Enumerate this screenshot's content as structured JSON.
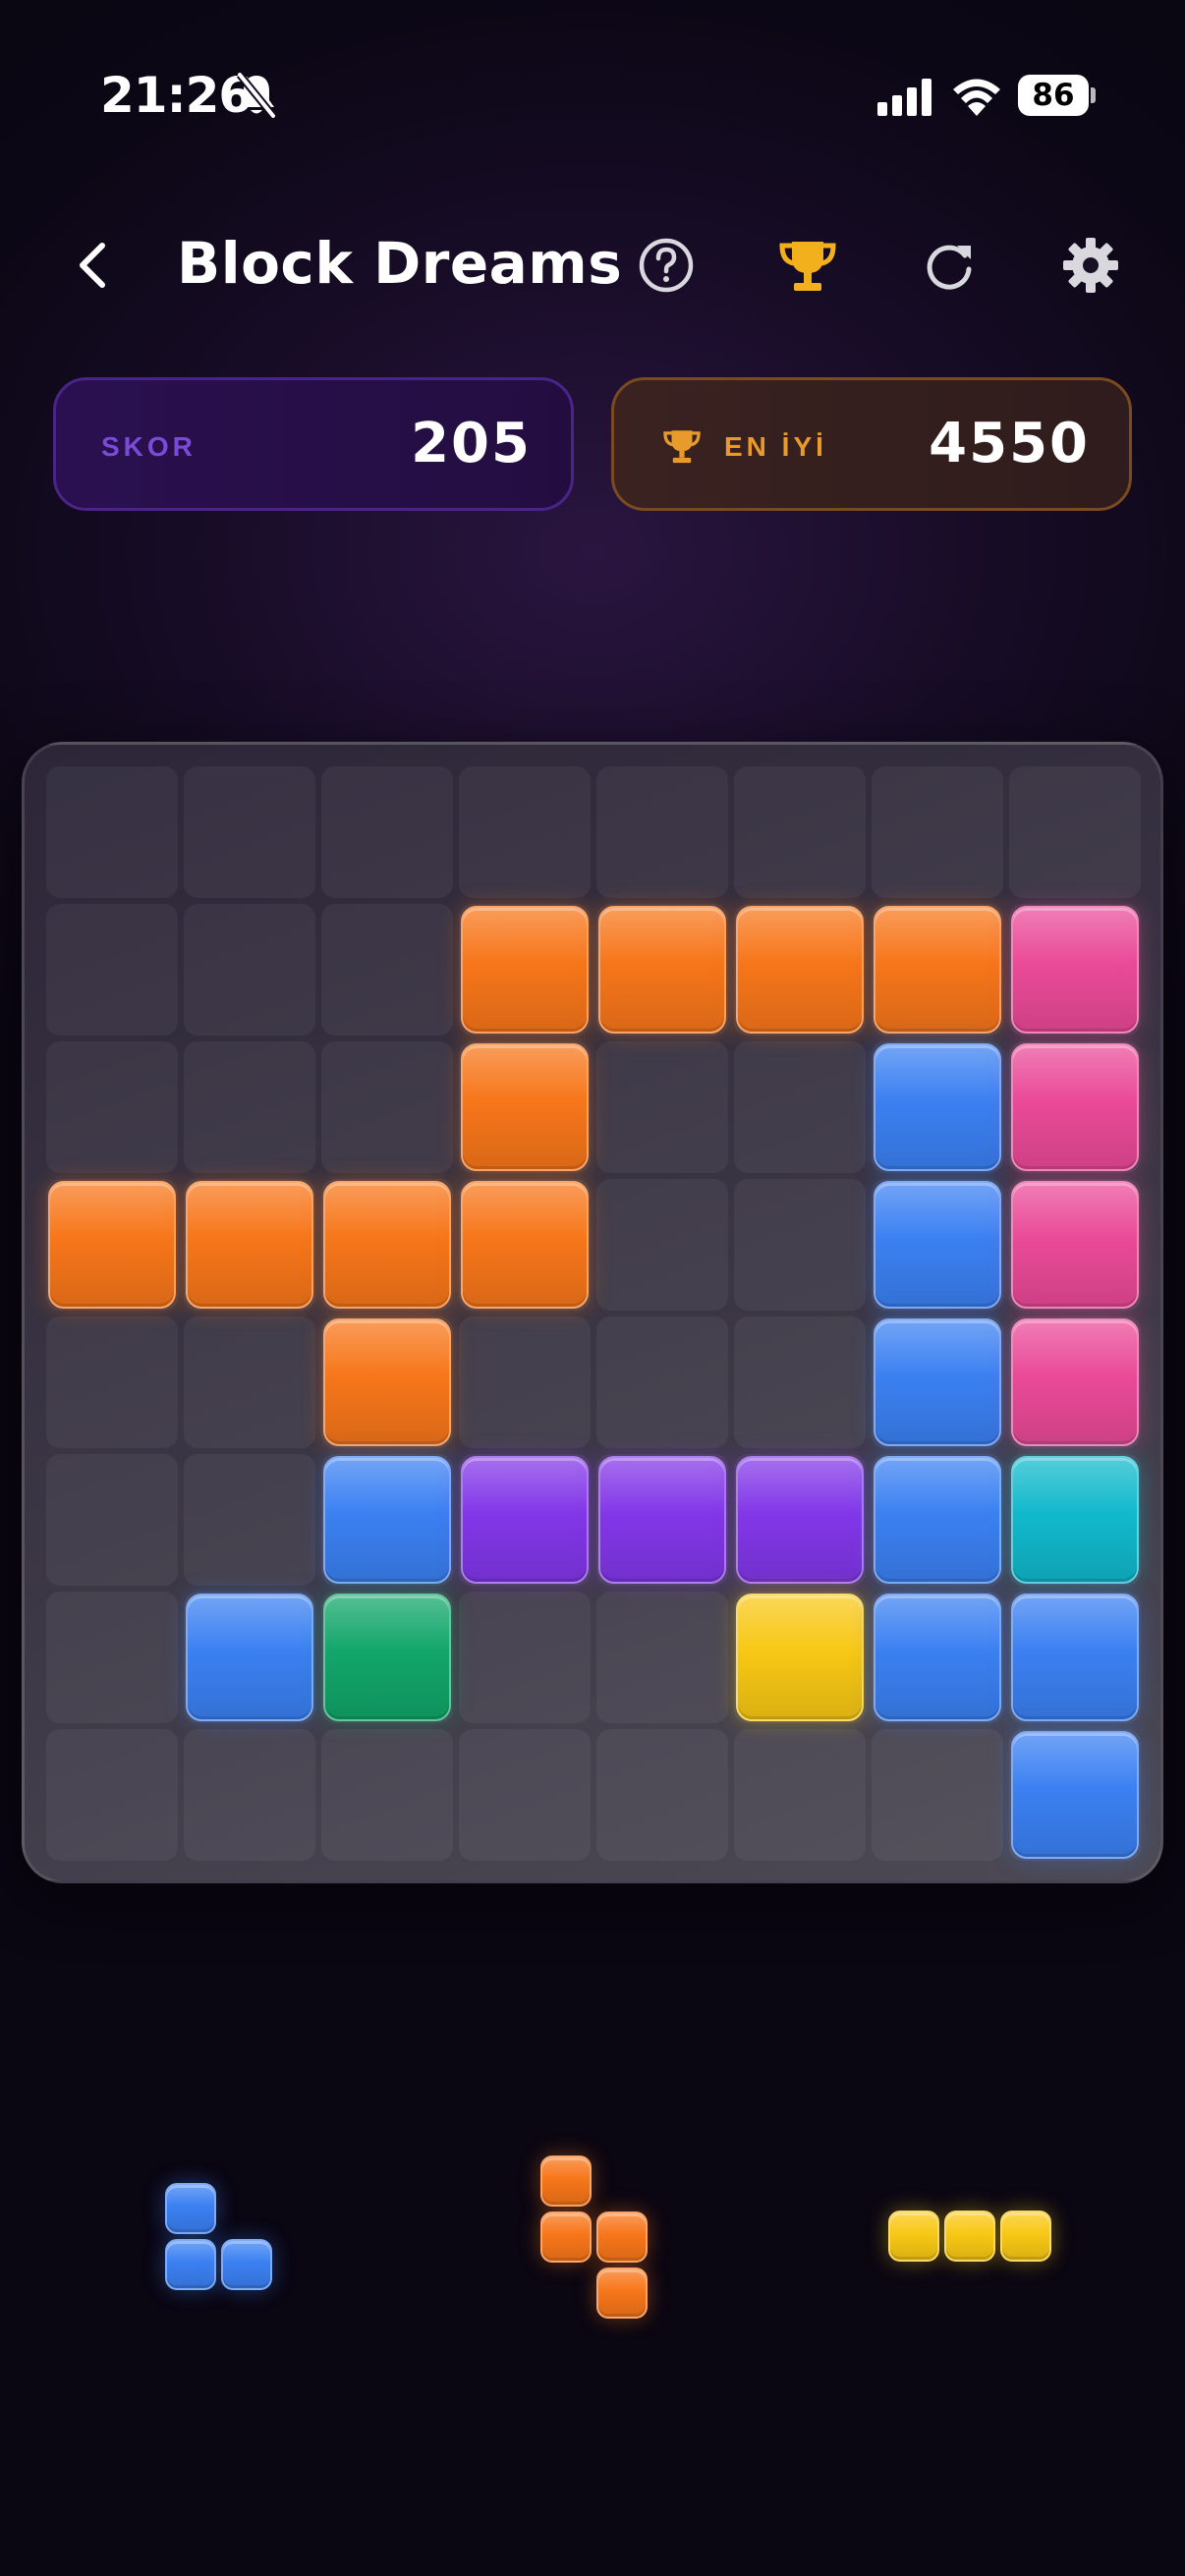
{
  "status_bar": {
    "time": "21:26",
    "battery": "86"
  },
  "header": {
    "title": "Block Dreams"
  },
  "score": {
    "label": "SKOR",
    "value": "205"
  },
  "best": {
    "label": "EN İYİ",
    "value": "4550"
  },
  "colors": {
    "orange": "#f7761a",
    "pink": "#ea4a98",
    "blue": "#3b80f2",
    "purple": "#8237e8",
    "cyan": "#11b9cc",
    "green": "#12a66a",
    "yellow": "#f8c815",
    "gold": "#f2b01c"
  },
  "board": {
    "rows": 8,
    "cols": 8,
    "grid": [
      [
        null,
        null,
        null,
        null,
        null,
        null,
        null,
        null
      ],
      [
        null,
        null,
        null,
        "orange",
        "orange",
        "orange",
        "orange",
        "pink"
      ],
      [
        null,
        null,
        null,
        "orange",
        null,
        null,
        "blue",
        "pink"
      ],
      [
        "orange",
        "orange",
        "orange",
        "orange",
        null,
        null,
        "blue",
        "pink"
      ],
      [
        null,
        null,
        "orange",
        null,
        null,
        null,
        "blue",
        "pink"
      ],
      [
        null,
        null,
        "blue",
        "purple",
        "purple",
        "purple",
        "blue",
        "cyan"
      ],
      [
        null,
        "blue",
        "green",
        null,
        null,
        "yellow",
        "blue",
        "blue"
      ],
      [
        null,
        null,
        null,
        null,
        null,
        null,
        null,
        "blue"
      ]
    ]
  },
  "pieces": [
    {
      "color": "blue",
      "cells": [
        [
          0,
          0
        ],
        [
          1,
          0
        ],
        [
          1,
          1
        ]
      ]
    },
    {
      "color": "orange",
      "cells": [
        [
          0,
          0
        ],
        [
          1,
          0
        ],
        [
          1,
          1
        ],
        [
          2,
          1
        ]
      ]
    },
    {
      "color": "yellow",
      "cells": [
        [
          0,
          0
        ],
        [
          0,
          1
        ],
        [
          0,
          2
        ]
      ]
    }
  ]
}
